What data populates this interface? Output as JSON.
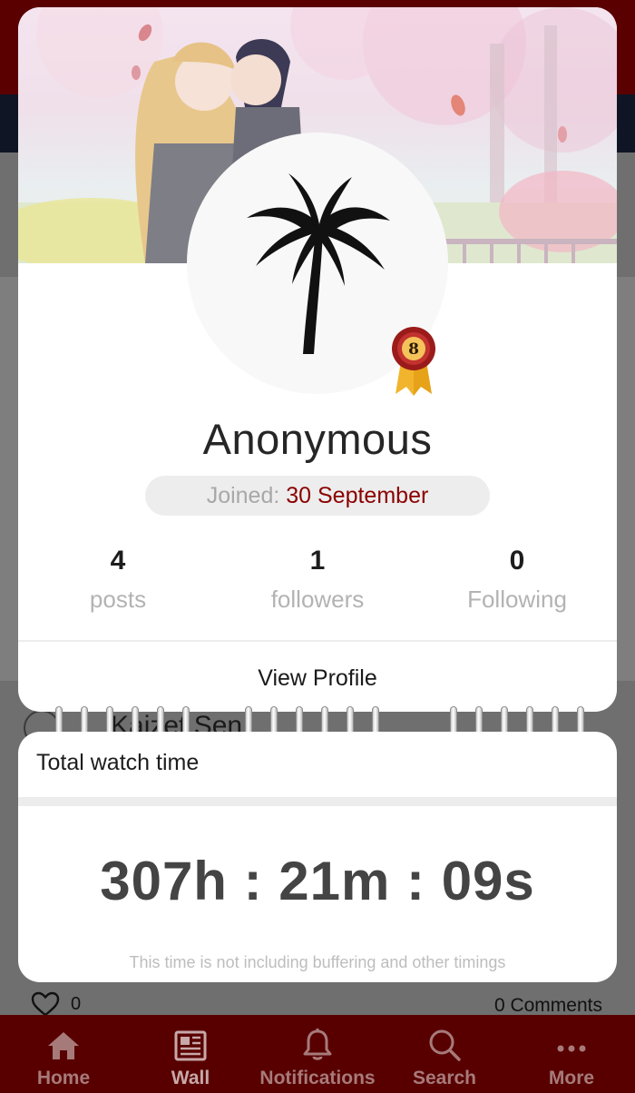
{
  "background_page": {
    "post_title": "Kaizet Sen",
    "likes_count": "0",
    "comments_label": "0 Comments"
  },
  "bottom_nav": {
    "items": [
      {
        "label": "Home",
        "icon": "home-icon"
      },
      {
        "label": "Wall",
        "icon": "newspaper-icon"
      },
      {
        "label": "Notifications",
        "icon": "bell-icon"
      },
      {
        "label": "Search",
        "icon": "search-icon"
      },
      {
        "label": "More",
        "icon": "more-dots-icon"
      }
    ],
    "active": "Wall"
  },
  "profile": {
    "cover_image": "anime-couple-cover",
    "avatar_icon": "palm-tree-icon",
    "level_badge": "8",
    "username": "Anonymous",
    "joined_label": "Joined: ",
    "joined_date": "30 September",
    "stats": [
      {
        "value": "4",
        "label": "posts"
      },
      {
        "value": "1",
        "label": "followers"
      },
      {
        "value": "0",
        "label": "Following"
      }
    ],
    "view_profile_label": "View Profile"
  },
  "watch_time": {
    "title": "Total watch time",
    "value": "307h : 21m : 09s",
    "note": "This time is not including buffering and other timings"
  },
  "colors": {
    "brand_dark_red": "#580000",
    "accent_red": "#8b0000",
    "text_dark": "#262626",
    "muted": "#b3b3b3"
  }
}
